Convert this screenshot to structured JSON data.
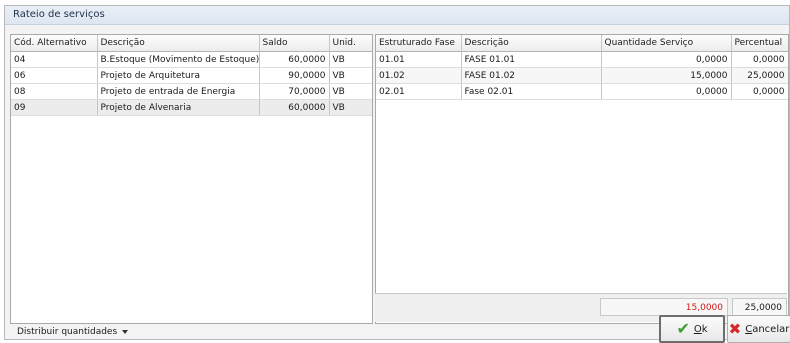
{
  "dialog": {
    "title": "Rateio de serviços"
  },
  "left_table": {
    "columns": [
      "Cód. Alternativo",
      "Descrição",
      "Saldo",
      "Unid."
    ],
    "rows": [
      {
        "code": "04",
        "desc": "B.Estoque (Movimento de Estoque)",
        "saldo": "60,0000",
        "unid": "VB"
      },
      {
        "code": "06",
        "desc": "Projeto de Arquitetura",
        "saldo": "90,0000",
        "unid": "VB"
      },
      {
        "code": "08",
        "desc": "Projeto de entrada de Energia",
        "saldo": "70,0000",
        "unid": "VB"
      },
      {
        "code": "09",
        "desc": "Projeto de Alvenaria",
        "saldo": "60,0000",
        "unid": "VB"
      }
    ]
  },
  "right_table": {
    "columns": [
      "Estruturado Fase",
      "Descrição",
      "Quantidade Serviço",
      "Percentual"
    ],
    "rows": [
      {
        "fase": "01.01",
        "desc": "FASE 01.01",
        "qtd": "0,0000",
        "pct": "0,0000"
      },
      {
        "fase": "01.02",
        "desc": "FASE 01.02",
        "qtd": "15,0000",
        "pct": "25,0000"
      },
      {
        "fase": "02.01",
        "desc": "Fase 02.01",
        "qtd": "0,0000",
        "pct": "0,0000"
      }
    ],
    "totals": {
      "qtd": "15,0000",
      "pct": "25,0000"
    }
  },
  "footer": {
    "distribuir_label": "Distribuir quantidades",
    "ok_label": "Ok",
    "cancel_label": "Cancelar"
  },
  "icons": {
    "ok": "check-icon",
    "cancel": "x-icon",
    "dropdown": "caret-down-icon"
  },
  "colors": {
    "total_qty_text": "#d11a1a",
    "ok_icon": "#3aa02d",
    "cancel_icon": "#d62828"
  }
}
